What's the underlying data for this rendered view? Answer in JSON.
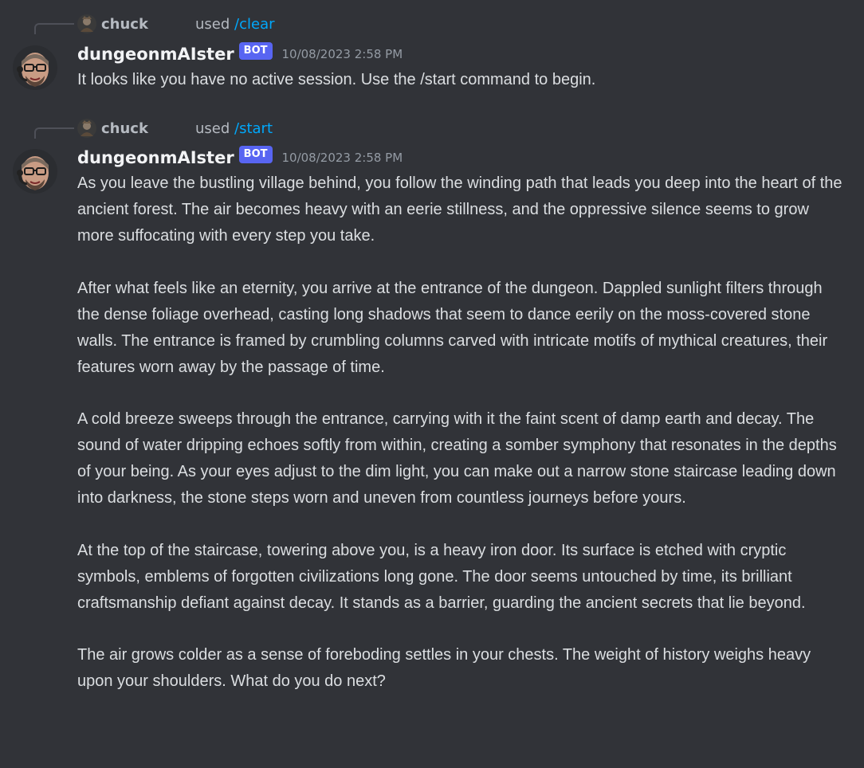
{
  "messages": [
    {
      "reply_user": "chuck",
      "reply_used": "used",
      "reply_command": "/clear",
      "author": "dungeonmAIster",
      "bot_tag": "BOT",
      "timestamp": "10/08/2023 2:58 PM",
      "paragraphs": [
        "It looks like you have no active session. Use the /start command to begin."
      ]
    },
    {
      "reply_user": "chuck",
      "reply_used": "used",
      "reply_command": "/start",
      "author": "dungeonmAIster",
      "bot_tag": "BOT",
      "timestamp": "10/08/2023 2:58 PM",
      "paragraphs": [
        "As you leave the bustling village behind, you follow the winding path that leads you deep into the heart of the ancient forest. The air becomes heavy with an eerie stillness, and the oppressive silence seems to grow more suffocating with every step you take.",
        "After what feels like an eternity, you arrive at the entrance of the dungeon. Dappled sunlight filters through the dense foliage overhead, casting long shadows that seem to dance eerily on the moss-covered stone walls. The entrance is framed by crumbling columns carved with intricate motifs of mythical creatures, their features worn away by the passage of time.",
        "A cold breeze sweeps through the entrance, carrying with it the faint scent of damp earth and decay. The sound of water dripping echoes softly from within, creating a somber symphony that resonates in the depths of your being. As your eyes adjust to the dim light, you can make out a narrow stone staircase leading down into darkness, the stone steps worn and uneven from countless journeys before yours.",
        "At the top of the staircase, towering above you, is a heavy iron door. Its surface is etched with cryptic symbols, emblems of forgotten civilizations long gone. The door seems untouched by time, its brilliant craftsmanship defiant against decay. It stands as a barrier, guarding the ancient secrets that lie beyond.",
        "The air grows colder as a sense of foreboding settles in your chests. The weight of history weighs heavy upon your shoulders. What do you do next?"
      ]
    }
  ],
  "colors": {
    "background": "#313338",
    "text": "#dbdee1",
    "author": "#f2f3f5",
    "command_link": "#00a8fc",
    "bot_tag": "#5865f2",
    "timestamp": "#949ba4"
  }
}
